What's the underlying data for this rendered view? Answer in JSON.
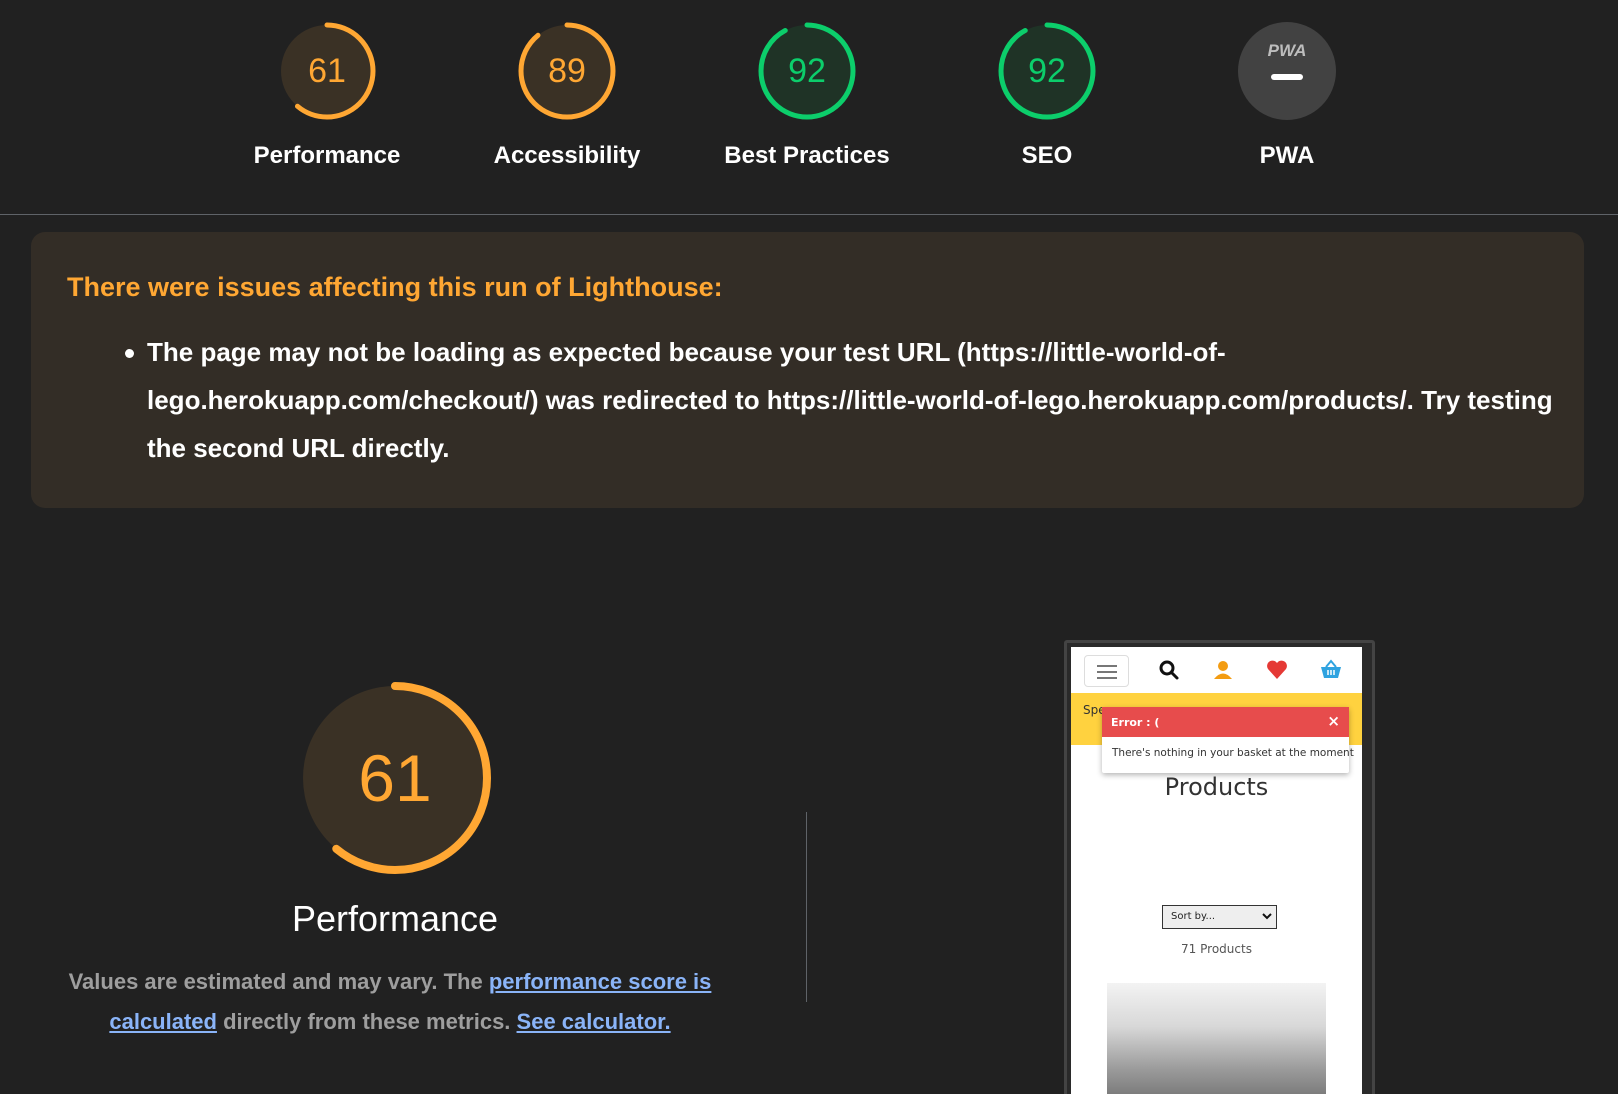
{
  "categories": [
    {
      "score": "61",
      "label": "Performance",
      "fraction": 0.61,
      "color": "#ffa733",
      "fill": "#3a3125"
    },
    {
      "score": "89",
      "label": "Accessibility",
      "fraction": 0.89,
      "color": "#ffa733",
      "fill": "#3a3125"
    },
    {
      "score": "92",
      "label": "Best Practices",
      "fraction": 0.92,
      "color": "#0cce6b",
      "fill": "#1f3326"
    },
    {
      "score": "92",
      "label": "SEO",
      "fraction": 0.92,
      "color": "#0cce6b",
      "fill": "#1f3326"
    },
    {
      "score": "PWA",
      "label": "PWA",
      "fraction": 0,
      "color": "#ffffff",
      "fill": "#424242"
    }
  ],
  "warning": {
    "title": "There were issues affecting this run of Lighthouse:",
    "items": [
      "The page may not be loading as expected because your test URL (https://little-world-of-lego.herokuapp.com/checkout/) was redirected to https://little-world-of-lego.herokuapp.com/products/. Try testing the second URL directly."
    ]
  },
  "performance": {
    "score": "61",
    "fraction": 0.61,
    "title": "Performance",
    "note_prefix": "Values are estimated and may vary. The ",
    "note_link1": "performance score is calculated",
    "note_middle": " directly from these metrics. ",
    "note_link2": "See calculator."
  },
  "screenshot": {
    "banner_text": "Spe",
    "toast_title": "Error : (",
    "toast_close": "×",
    "toast_message": "There's nothing in your basket at the moment",
    "heading": "Products",
    "sort_label": "Sort by...",
    "count": "71 Products"
  },
  "colors": {
    "background": "#212121",
    "average": "#ffa733",
    "pass": "#0cce6b",
    "link": "#8ab4f8",
    "warning_bg": "#332d26"
  }
}
